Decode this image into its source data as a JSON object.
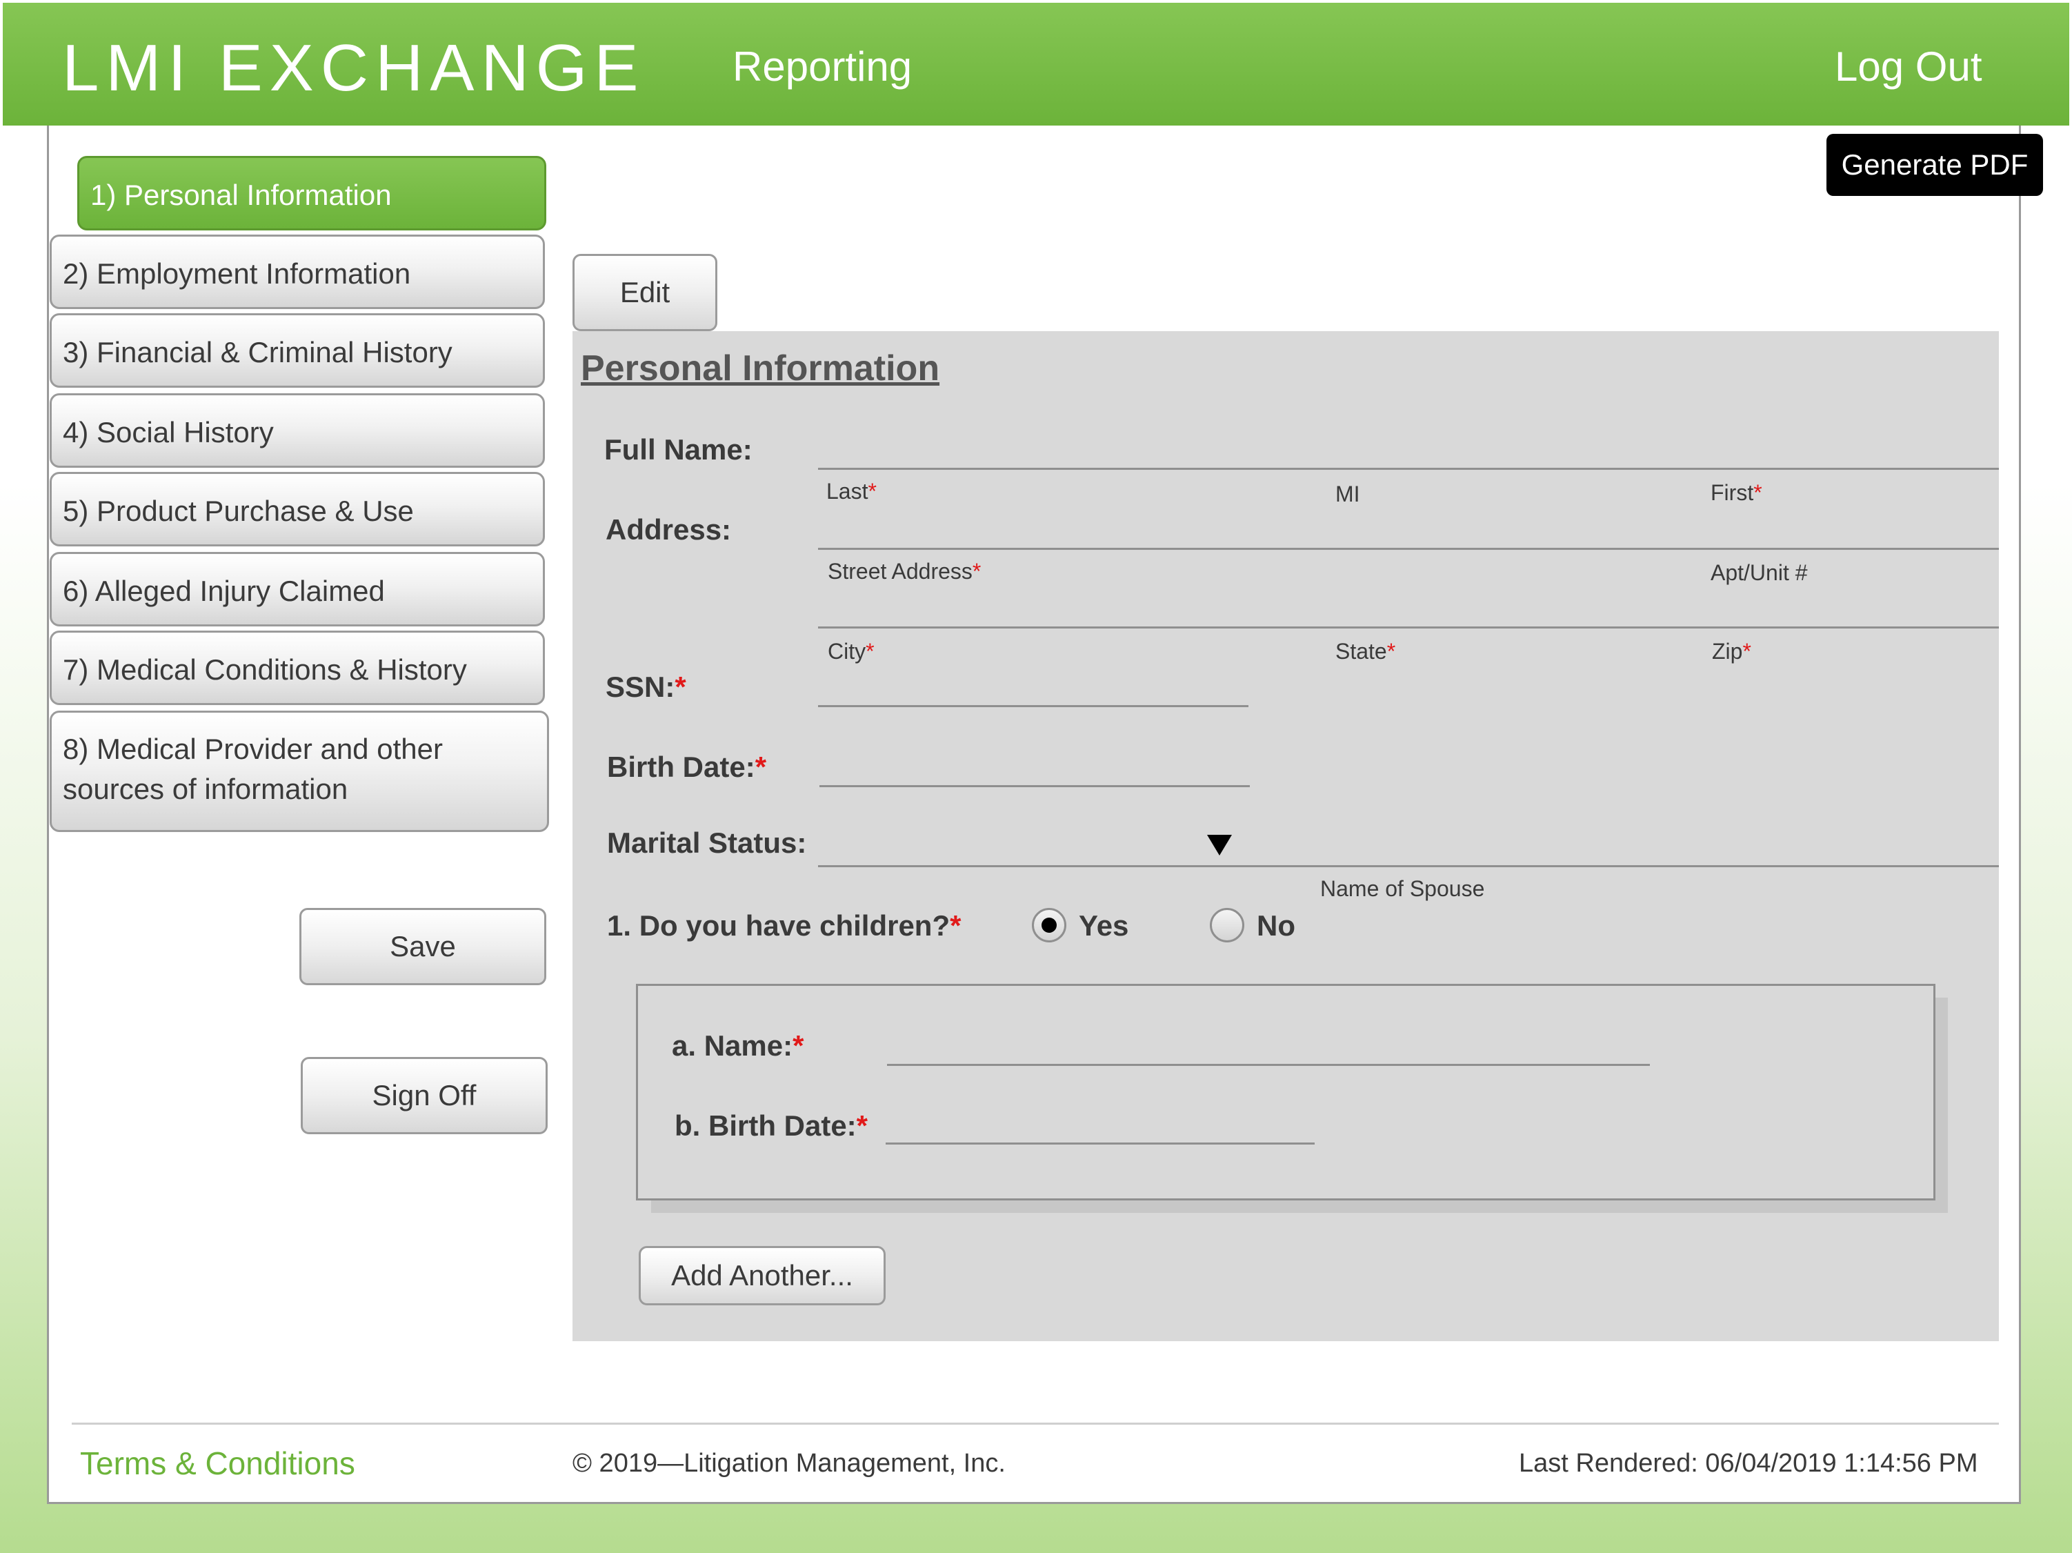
{
  "header": {
    "logo": "LMI EXCHANGE",
    "nav_reporting": "Reporting",
    "logout": "Log Out"
  },
  "toolbar": {
    "generate_pdf": "Generate PDF",
    "edit": "Edit"
  },
  "sidebar": {
    "items": [
      {
        "label": "1)  Personal Information",
        "active": true
      },
      {
        "label": "2)  Employment Information"
      },
      {
        "label": "3)  Financial & Criminal History"
      },
      {
        "label": "4)  Social History"
      },
      {
        "label": "5)  Product Purchase & Use"
      },
      {
        "label": "6)  Alleged Injury Claimed"
      },
      {
        "label": "7)  Medical Conditions & History"
      },
      {
        "label": "8)  Medical Provider and other sources of information"
      }
    ],
    "save": "Save",
    "sign_off": "Sign Off"
  },
  "form": {
    "title": "Personal Information",
    "full_name_label": "Full Name:",
    "last": "Last",
    "mi": "MI",
    "first": "First",
    "address_label": "Address:",
    "street": "Street Address",
    "apt": "Apt/Unit #",
    "city": "City",
    "state": "State",
    "zip": "Zip",
    "ssn_label": "SSN:",
    "birth_date_label": "Birth Date:",
    "marital_label": "Marital Status:",
    "marital_value": "",
    "spouse": "Name of Spouse",
    "children_question": "1.  Do you have children?",
    "yes": "Yes",
    "no": "No",
    "children_selected": "Yes",
    "child_name_label": "a.  Name:",
    "child_birth_label": "b.  Birth Date:",
    "add_another": "Add Another...",
    "required_mark": "*"
  },
  "footer": {
    "terms": "Terms & Conditions",
    "copyright": "© 2019—Litigation Management, Inc.",
    "last_rendered": "Last Rendered:  06/04/2019  1:14:56 PM"
  },
  "colors": {
    "brand_green": "#6cb33a",
    "required_red": "#e11a1a"
  }
}
